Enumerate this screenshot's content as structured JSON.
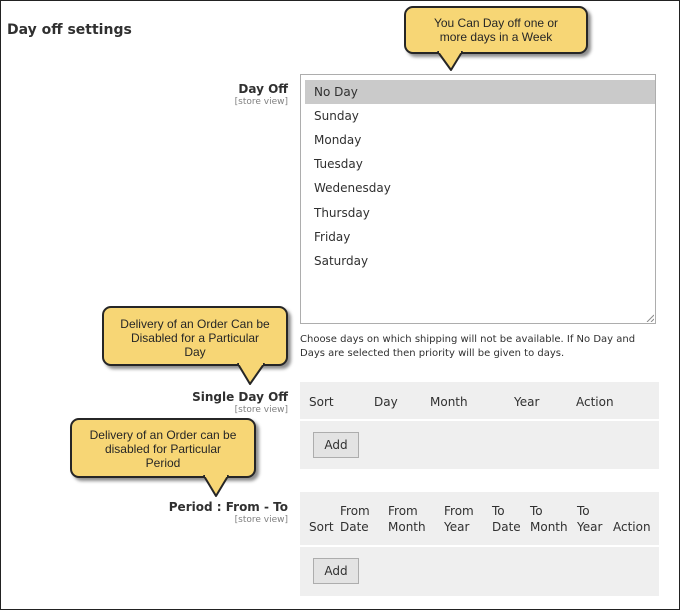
{
  "section": {
    "title": "Day off settings"
  },
  "day_off": {
    "label": "Day Off",
    "scope": "[store view]",
    "options": [
      "No Day",
      "Sunday",
      "Monday",
      "Tuesday",
      "Wedenesday",
      "Thursday",
      "Friday",
      "Saturday"
    ],
    "selected": "No Day",
    "note": "Choose days on which shipping will not be available. If No Day and Days are selected then priority will be given to days."
  },
  "single_day_off": {
    "label": "Single Day Off",
    "scope": "[store view]",
    "columns": [
      "Sort",
      "Day",
      "Month",
      "Year",
      "Action"
    ],
    "add_label": "Add"
  },
  "period": {
    "label": "Period : From - To",
    "scope": "[store view]",
    "columns": [
      [
        "Sort"
      ],
      [
        "From",
        "Date"
      ],
      [
        "From",
        "Month"
      ],
      [
        "From",
        "Year"
      ],
      [
        "To",
        "Date"
      ],
      [
        "To",
        "Month"
      ],
      [
        "To",
        "Year"
      ],
      [
        "Action"
      ]
    ],
    "add_label": "Add"
  },
  "callouts": {
    "week": [
      "You Can Day off one or",
      "more days in a Week"
    ],
    "single": [
      "Delivery of an Order Can be",
      "Disabled for a Particular",
      "Day"
    ],
    "period": [
      "Delivery of an Order can be",
      "disabled for Particular",
      "Period"
    ]
  },
  "colors": {
    "callout_fill": "#f7d675",
    "selected_option": "#cacaca",
    "grid_bg": "#efefef"
  }
}
